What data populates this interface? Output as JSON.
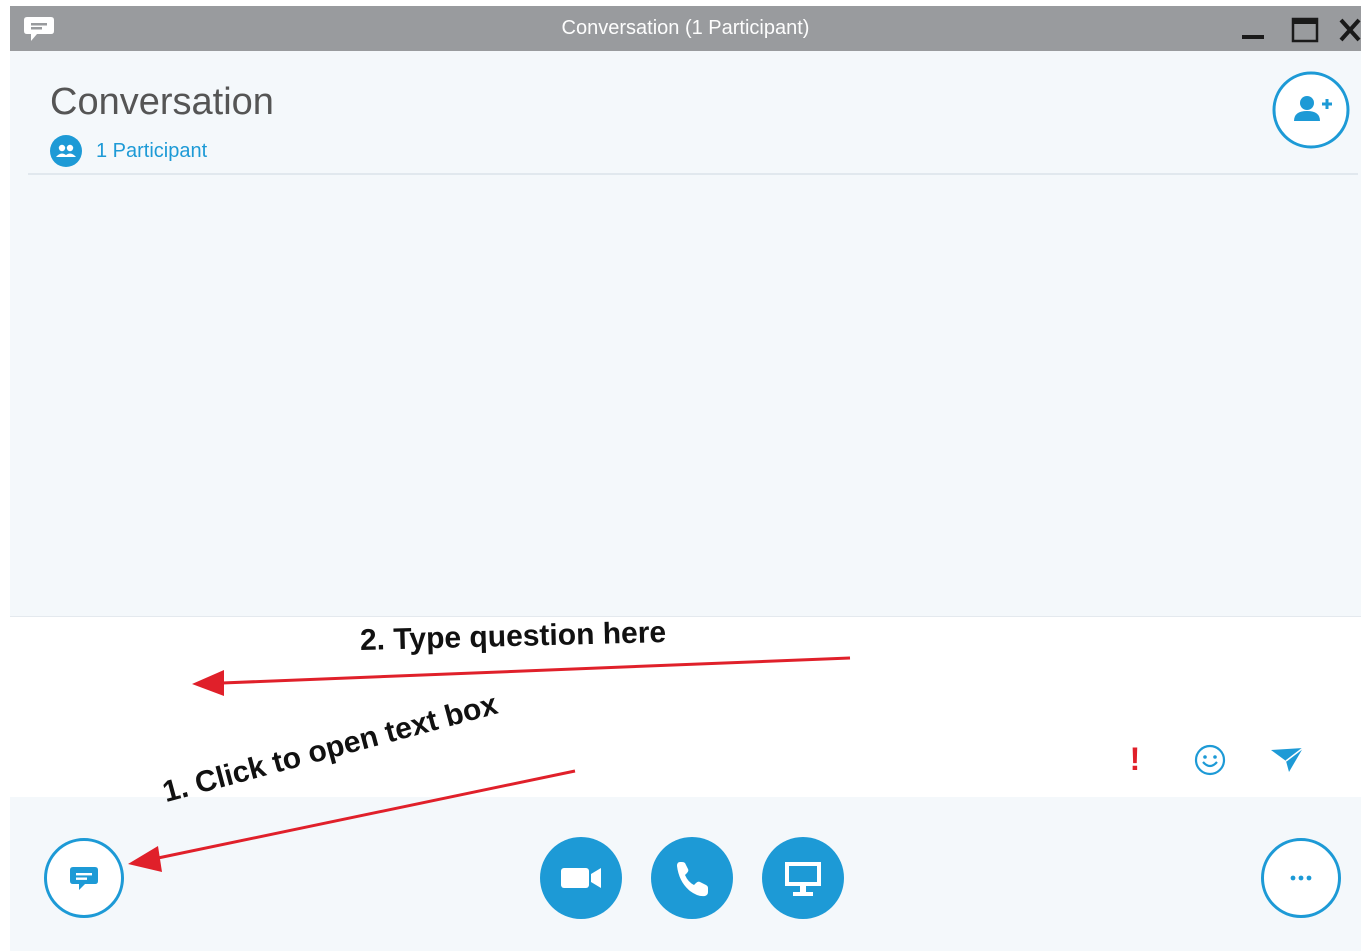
{
  "window": {
    "title": "Conversation (1 Participant)",
    "app_icon": "chat-bubble-icon",
    "controls": [
      "minimize-icon",
      "maximize-icon",
      "close-icon"
    ]
  },
  "header": {
    "title": "Conversation",
    "participants_label": "1 Participant",
    "participants_icon": "people-icon",
    "add_person_icon": "add-person-icon"
  },
  "compose": {
    "placeholder": "",
    "importance_symbol": "!",
    "icons": [
      "importance-icon",
      "emoticon-icon",
      "send-icon"
    ]
  },
  "toolbar": {
    "left_icon": "im-chat-icon",
    "center_icons": [
      "video-camera-icon",
      "phone-icon",
      "present-screen-icon"
    ],
    "right_icon": "more-options-icon"
  },
  "annotations": {
    "step_2": "2. Type question here",
    "step_1": "1. Click to open text box"
  },
  "colors": {
    "titlebar": "#999b9e",
    "accent": "#1d9ad6",
    "importance": "#e0202a",
    "arrow": "#e0202a",
    "background": "#f4f8fb"
  }
}
